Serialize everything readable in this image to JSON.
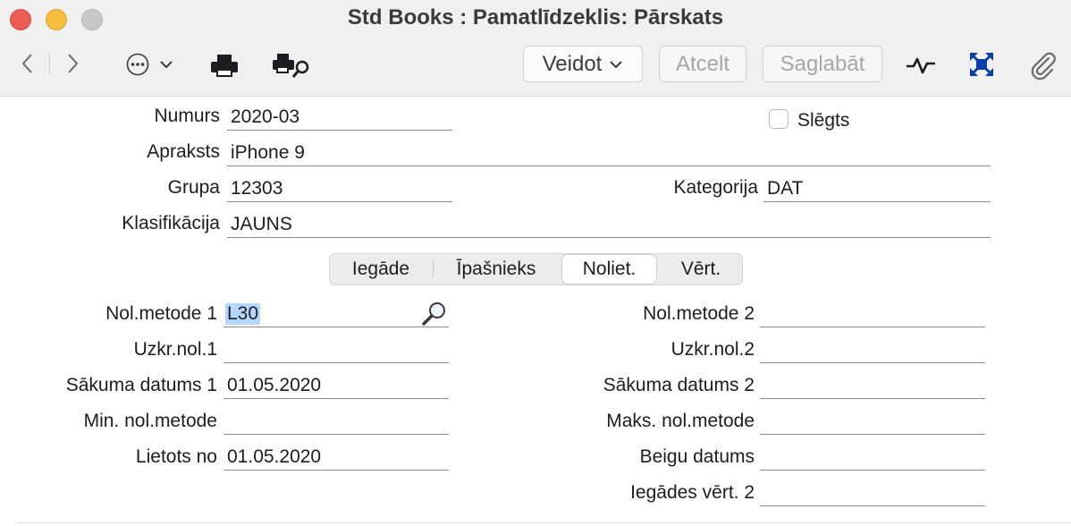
{
  "window": {
    "title": "Std Books : Pamatlīdzeklis: Pārskats"
  },
  "toolbar": {
    "icons": [
      "back-icon",
      "forward-icon",
      "more-icon",
      "chevron-down-icon",
      "print-icon",
      "print-preview-icon",
      "activity-icon",
      "expand-icon",
      "attachment-icon"
    ],
    "create_label": "Veidot",
    "cancel_label": "Atcelt",
    "save_label": "Saglabāt"
  },
  "header": {
    "number_label": "Numurs",
    "number_value": "2020-03",
    "closed_label": "Slēgts",
    "closed_checked": false,
    "description_label": "Apraksts",
    "description_value": "iPhone 9",
    "group_label": "Grupa",
    "group_value": "12303",
    "category_label": "Kategorija",
    "category_value": "DAT",
    "classification_label": "Klasifikācija",
    "classification_value": "JAUNS"
  },
  "tabs": [
    {
      "label": "Iegāde",
      "active": false
    },
    {
      "label": "Īpašnieks",
      "active": false
    },
    {
      "label": "Noliet.",
      "active": true
    },
    {
      "label": "Vērt.",
      "active": false
    }
  ],
  "depreciation": {
    "left": [
      {
        "label": "Nol.metode 1",
        "value": "L30"
      },
      {
        "label": "Uzkr.nol.1",
        "value": ""
      },
      {
        "label": "Sākuma datums 1",
        "value": "01.05.2020"
      },
      {
        "label": "Min. nol.metode",
        "value": ""
      },
      {
        "label": "Lietots no",
        "value": "01.05.2020"
      }
    ],
    "right": [
      {
        "label": "Nol.metode 2",
        "value": ""
      },
      {
        "label": "Uzkr.nol.2",
        "value": ""
      },
      {
        "label": "Sākuma datums 2",
        "value": ""
      },
      {
        "label": "Maks. nol.metode",
        "value": ""
      },
      {
        "label": "Beigu datums",
        "value": ""
      },
      {
        "label": "Iegādes vērt. 2",
        "value": ""
      }
    ]
  }
}
